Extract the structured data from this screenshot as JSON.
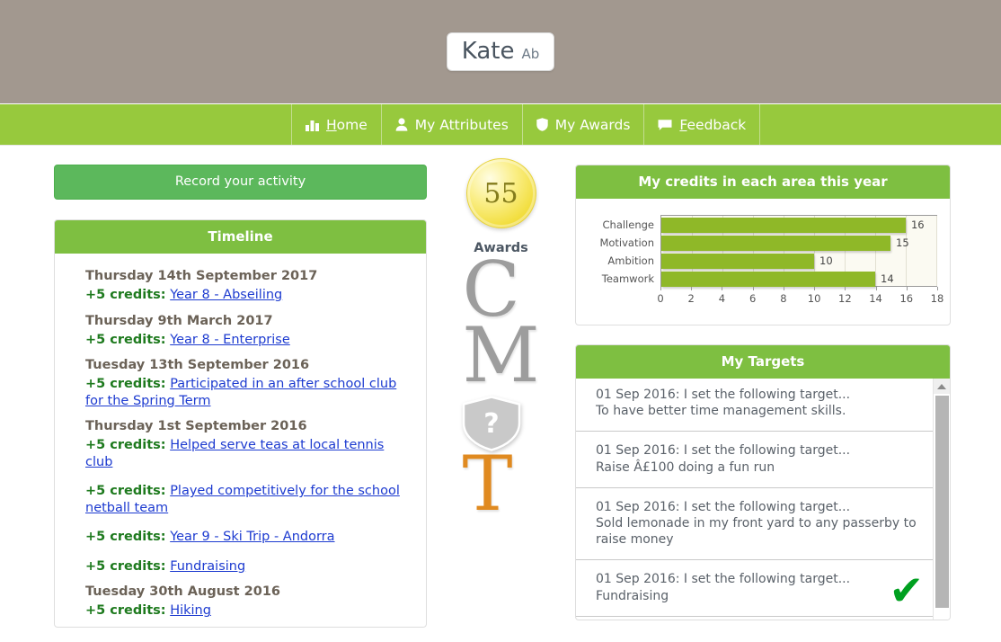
{
  "header": {
    "user_first_name": "Kate",
    "user_initials": "Ab"
  },
  "nav": {
    "items": [
      {
        "label": "Home",
        "accesskey": "H",
        "icon": "bar-chart-icon"
      },
      {
        "label": "My Attributes",
        "accesskey": "",
        "icon": "user-icon"
      },
      {
        "label": "My Awards",
        "accesskey": "",
        "icon": "shield-icon"
      },
      {
        "label": "Feedback",
        "accesskey": "F",
        "icon": "speech-bubble-icon"
      }
    ]
  },
  "left": {
    "record_button": "Record your activity",
    "timeline_title": "Timeline",
    "timeline": [
      {
        "type": "date",
        "text": "Thursday 14th September 2017"
      },
      {
        "type": "entry",
        "credits": "+5 credits:",
        "link": "Year 8 - Abseiling",
        "spaced": false
      },
      {
        "type": "date",
        "text": "Thursday 9th March 2017"
      },
      {
        "type": "entry",
        "credits": "+5 credits:",
        "link": "Year 8 - Enterprise",
        "spaced": false
      },
      {
        "type": "date",
        "text": "Tuesday 13th September 2016"
      },
      {
        "type": "entry",
        "credits": "+5 credits:",
        "link": "Participated in an after school club for the Spring Term",
        "spaced": false
      },
      {
        "type": "date",
        "text": "Thursday 1st September 2016"
      },
      {
        "type": "entry",
        "credits": "+5 credits:",
        "link": "Helped serve teas at local tennis club",
        "spaced": false
      },
      {
        "type": "entry",
        "credits": "+5 credits:",
        "link": "Played competitively for the school netball team",
        "spaced": true
      },
      {
        "type": "entry",
        "credits": "+5 credits:",
        "link": "Year 9 - Ski Trip - Andorra",
        "spaced": true
      },
      {
        "type": "entry",
        "credits": "+5 credits:",
        "link": "Fundraising",
        "spaced": true
      },
      {
        "type": "date",
        "text": "Tuesday 30th August 2016"
      },
      {
        "type": "entry",
        "credits": "+5 credits:",
        "link": "Hiking",
        "spaced": false
      }
    ]
  },
  "awards": {
    "credit_badge_value": "55",
    "label": "Awards",
    "items": [
      {
        "kind": "letter",
        "glyph": "C",
        "color": "#9d9d9d"
      },
      {
        "kind": "letter",
        "glyph": "M",
        "color": "#9d9d9d"
      },
      {
        "kind": "shield",
        "glyph": "?",
        "color": "#c9c9c9"
      },
      {
        "kind": "letter",
        "glyph": "T",
        "color": "#e08a20"
      }
    ]
  },
  "chart_data": {
    "type": "bar",
    "orientation": "horizontal",
    "title": "My credits in each area this year",
    "categories": [
      "Challenge",
      "Motivation",
      "Ambition",
      "Teamwork"
    ],
    "values": [
      16,
      15,
      10,
      14
    ],
    "xlabel": "",
    "ylabel": "",
    "xlim": [
      0,
      18
    ],
    "xticks": [
      0,
      2,
      4,
      6,
      8,
      10,
      12,
      14,
      16,
      18
    ],
    "bar_color": "#8fb828",
    "plot_background": "#fbfaf2",
    "grid": true,
    "legend": false,
    "data_labels": [
      "16",
      "15",
      "10",
      "14"
    ]
  },
  "targets": {
    "title": "My Targets",
    "items": [
      {
        "date_line": "01 Sep 2016: I set the following target...",
        "text": "To have better time management skills.",
        "completed": false
      },
      {
        "date_line": "01 Sep 2016: I set the following target...",
        "text": "Raise Â£100 doing a fun run",
        "completed": false
      },
      {
        "date_line": "01 Sep 2016: I set the following target...",
        "text": "Sold lemonade in my front yard to any passerby to raise money",
        "completed": false
      },
      {
        "date_line": "01 Sep 2016: I set the following target...",
        "text": "Fundraising",
        "completed": true
      }
    ],
    "check_glyph": "✔"
  }
}
